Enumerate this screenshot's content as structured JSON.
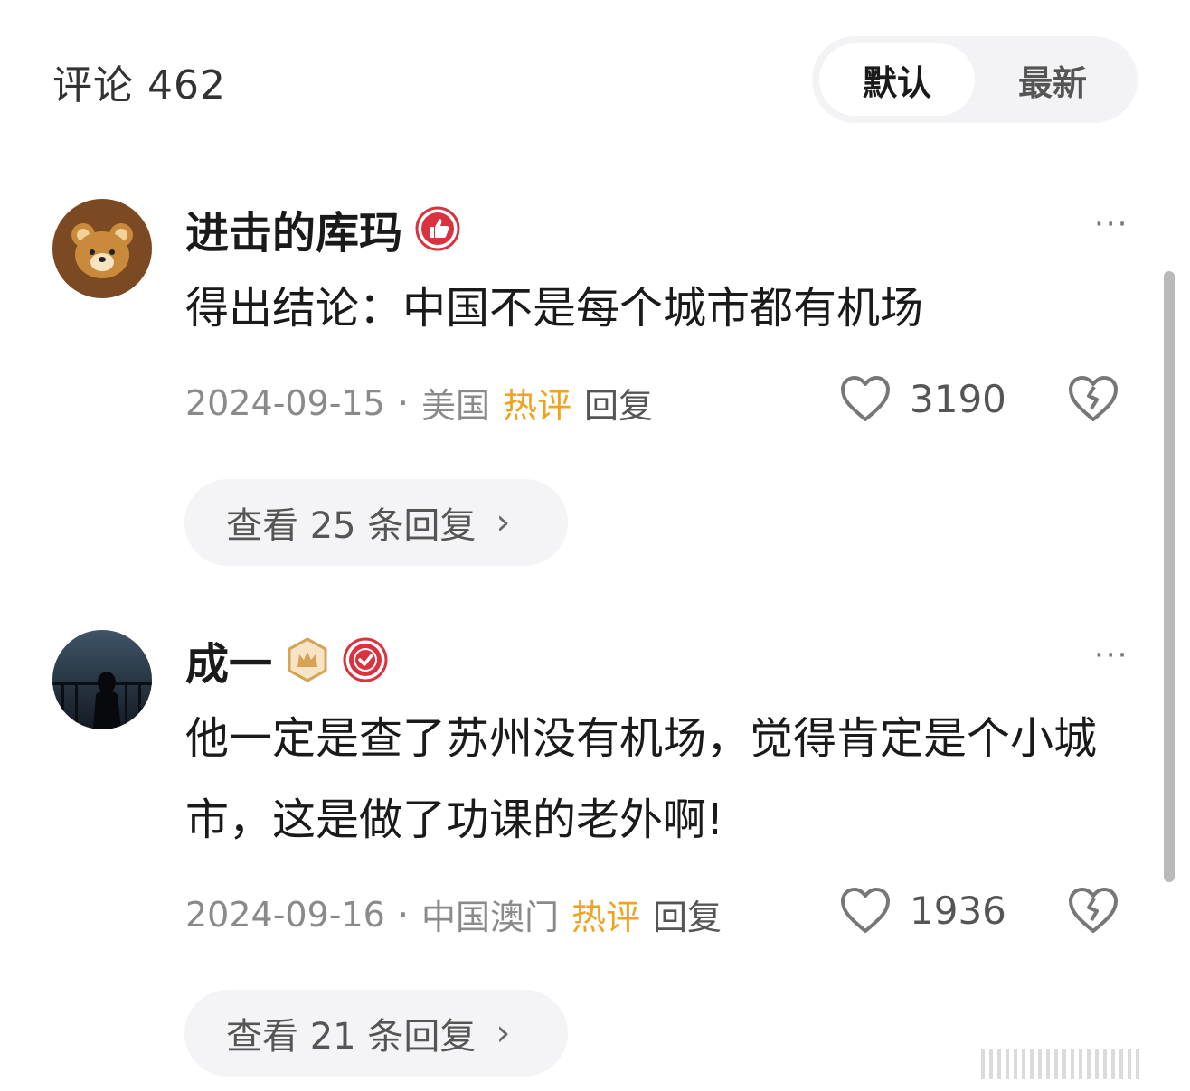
{
  "header": {
    "title": "评论 462",
    "sort_options": [
      "默认",
      "最新"
    ],
    "active_sort": "默认"
  },
  "comments": [
    {
      "username": "进击的库玛",
      "badges": [
        "thumbs-up-badge"
      ],
      "text": "得出结论：中国不是每个城市都有机场",
      "date": "2024-09-15",
      "location": "美国",
      "hot_label": "热评",
      "reply_label": "回复",
      "likes": "3190",
      "view_replies": "查看 25 条回复"
    },
    {
      "username": "成一",
      "badges": [
        "crown-badge",
        "check-badge"
      ],
      "text": "他一定是查了苏州没有机场，觉得肯定是个小城市，这是做了功课的老外啊!",
      "date": "2024-09-16",
      "location": "中国澳门",
      "hot_label": "热评",
      "reply_label": "回复",
      "likes": "1936",
      "view_replies": "查看 21 条回复"
    }
  ],
  "more_symbol": "···",
  "separator": "·",
  "chevron": "›",
  "colors": {
    "hot": "#f0a31e",
    "badge_red": "#d8333f",
    "badge_gold": "#d6a256"
  }
}
